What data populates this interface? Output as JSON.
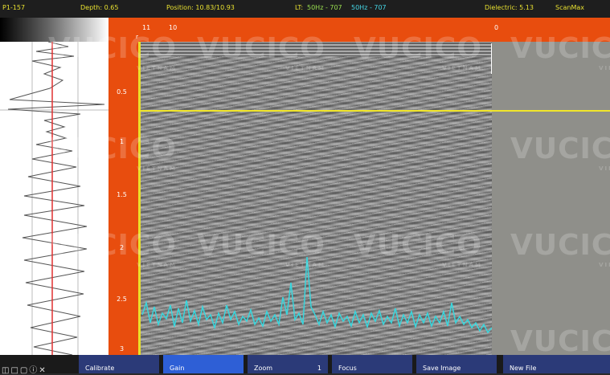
{
  "status": {
    "file_id": "P1-157",
    "depth": "Depth: 0.65",
    "position": "Position: 10.83/10.93",
    "lt_prefix": "LT:",
    "lt_hz1": "50Hz - 707",
    "lt_hz2": "50Hz - 707",
    "dielectric": "Dielectric: 5.13",
    "app_name": "ScanMax"
  },
  "axes": {
    "depth_unit": "m",
    "depth_ticks": [
      "0.5",
      "1",
      "1.5",
      "2",
      "2.5",
      "3"
    ],
    "position_ticks": [
      "11",
      "10",
      "0"
    ]
  },
  "watermark": {
    "brand": "VUCICO",
    "sub": "VIETNAM"
  },
  "toolbar": {
    "calibrate": "Calibrate",
    "gain": "Gain",
    "zoom": "Zoom",
    "zoom_value": "1",
    "focus": "Focus",
    "save_image": "Save Image",
    "new_file": "New File"
  },
  "icons": [
    "file-icon",
    "window-icon",
    "square-icon",
    "info-icon",
    "wrench-icon"
  ],
  "colors": {
    "accent": "#e84d0e",
    "cursor": "#f1e62a",
    "trace": "#38d6dd",
    "status_text": "#e8e030"
  }
}
